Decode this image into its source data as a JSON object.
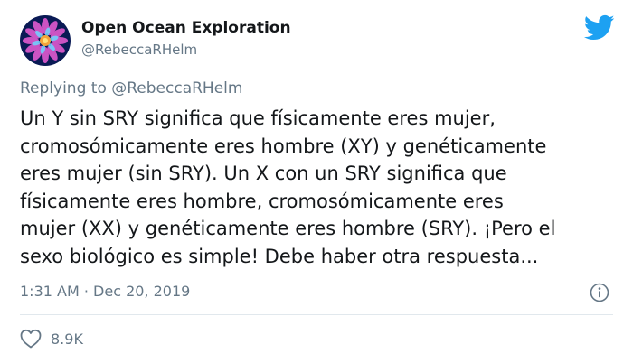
{
  "account": {
    "name": "Open Ocean Exploration",
    "handle": "@RebeccaRHelm"
  },
  "reply": {
    "prefix": "Replying to",
    "mention": "@RebeccaRHelm"
  },
  "tweet": {
    "lines": [
      "Un Y sin SRY significa que físicamente eres mujer,",
      "cromosómicamente eres hombre (XY) y genéticamente",
      "eres mujer (sin SRY). Un X con un SRY significa que",
      "físicamente eres hombre, cromosómicamente eres",
      "mujer (XX) y genéticamente eres hombre (SRY). ¡Pero el",
      "sexo biológico es simple! Debe haber otra respuesta..."
    ],
    "timestamp": "1:31 AM · Dec 20, 2019",
    "likes": "8.9K"
  },
  "icons": {
    "brand": "twitter-bird-icon",
    "info": "info-icon",
    "like": "heart-icon"
  },
  "colors": {
    "brand_blue": "#1da1f2",
    "muted_text": "#657786",
    "primary_text": "#14171a"
  }
}
